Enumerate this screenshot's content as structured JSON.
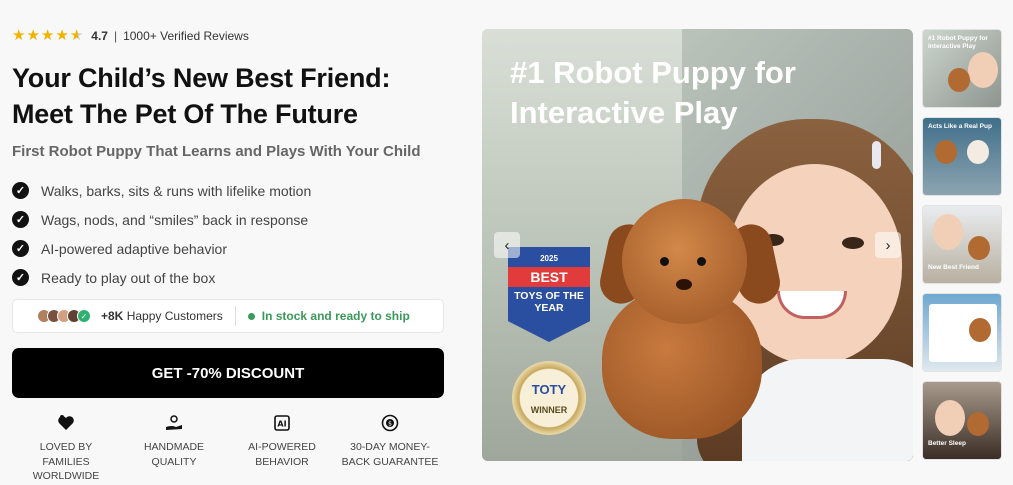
{
  "rating": {
    "value": "4.7",
    "separator": "|",
    "reviews": "1000+ Verified Reviews",
    "stars": 4.7
  },
  "headline": "Your Child’s New Best Friend: Meet The Pet Of The Future",
  "subhead": "First Robot Puppy That Learns and Plays With Your Child",
  "features": [
    "Walks, barks, sits & runs with lifelike motion",
    "Wags, nods, and “smiles” back in response",
    "AI-powered adaptive behavior",
    "Ready to play out of the box"
  ],
  "social": {
    "customers_count": "+8K",
    "customers_label": "Happy Customers",
    "stock": "In stock and ready to ship"
  },
  "cta": "GET -70% DISCOUNT",
  "badges": [
    {
      "icon": "heart-family-icon",
      "label": "LOVED BY FAMILIES WORLDWIDE"
    },
    {
      "icon": "handmade-hand-icon",
      "label": "HANDMADE QUALITY"
    },
    {
      "icon": "ai-chip-icon",
      "label": "AI-POWERED BEHAVIOR"
    },
    {
      "icon": "money-back-icon",
      "label": "30-DAY MONEY-BACK GUARANTEE"
    }
  ],
  "gallery": {
    "main_title": "#1 Robot Puppy for Interactive Play",
    "award": {
      "year": "2025",
      "best": "BEST",
      "toys": "TOYS OF THE YEAR"
    },
    "seal": {
      "brand": "TOTY",
      "winner": "WINNER"
    },
    "prev": "‹",
    "next": "›",
    "thumbnails": [
      {
        "label": "#1 Robot Puppy for Interactive Play"
      },
      {
        "label": "Acts Like a Real Pup"
      },
      {
        "label": "New Best Friend"
      },
      {
        "label": ""
      },
      {
        "label": "Better Sleep"
      }
    ]
  },
  "colors": {
    "accent": "#000000",
    "star": "#f0b400",
    "stock": "#3a9a5a",
    "award_blue": "#2b4fa0",
    "award_red": "#e23b3b"
  }
}
